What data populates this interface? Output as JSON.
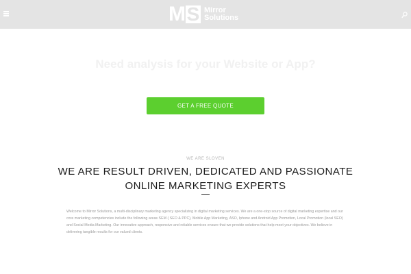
{
  "header": {
    "logo_initials_m": "M",
    "logo_initials_s": "S",
    "logo_line1": "Mirror",
    "logo_line2": "Solutions",
    "menu_icon": "hamburger-icon",
    "search_icon": "search-icon",
    "background": "#e4e4e4"
  },
  "hero": {
    "heading": "Need analysis for your Website or App?",
    "cta_label": "GET A FREE QUOTE",
    "cta_color": "#5ccf2f"
  },
  "about": {
    "eyebrow": "WE ARE SLOVEN",
    "heading_line1": "WE ARE RESULT DRIVEN, DEDICATED AND PASSIONATE",
    "heading_line2": "ONLINE MARKETING EXPERTS",
    "body": "Welcome to Mirror Solutions, a multi-disciplinary marketing agency specializing in digital marketing services. We are a one-stop source of digital marketing expertise and our core marketing competencies include the following areas SEM ( SEO & PPC), Mobile App Marketing, ASO, Iphone and Android App Promotion, Local Promotion (local SEO) and Social Media Marketing. Our innovative approach, responsive and reliable services ensure that we provide solutions that help meet your objectives. We believe in delivering tangible results for our valued clients."
  }
}
